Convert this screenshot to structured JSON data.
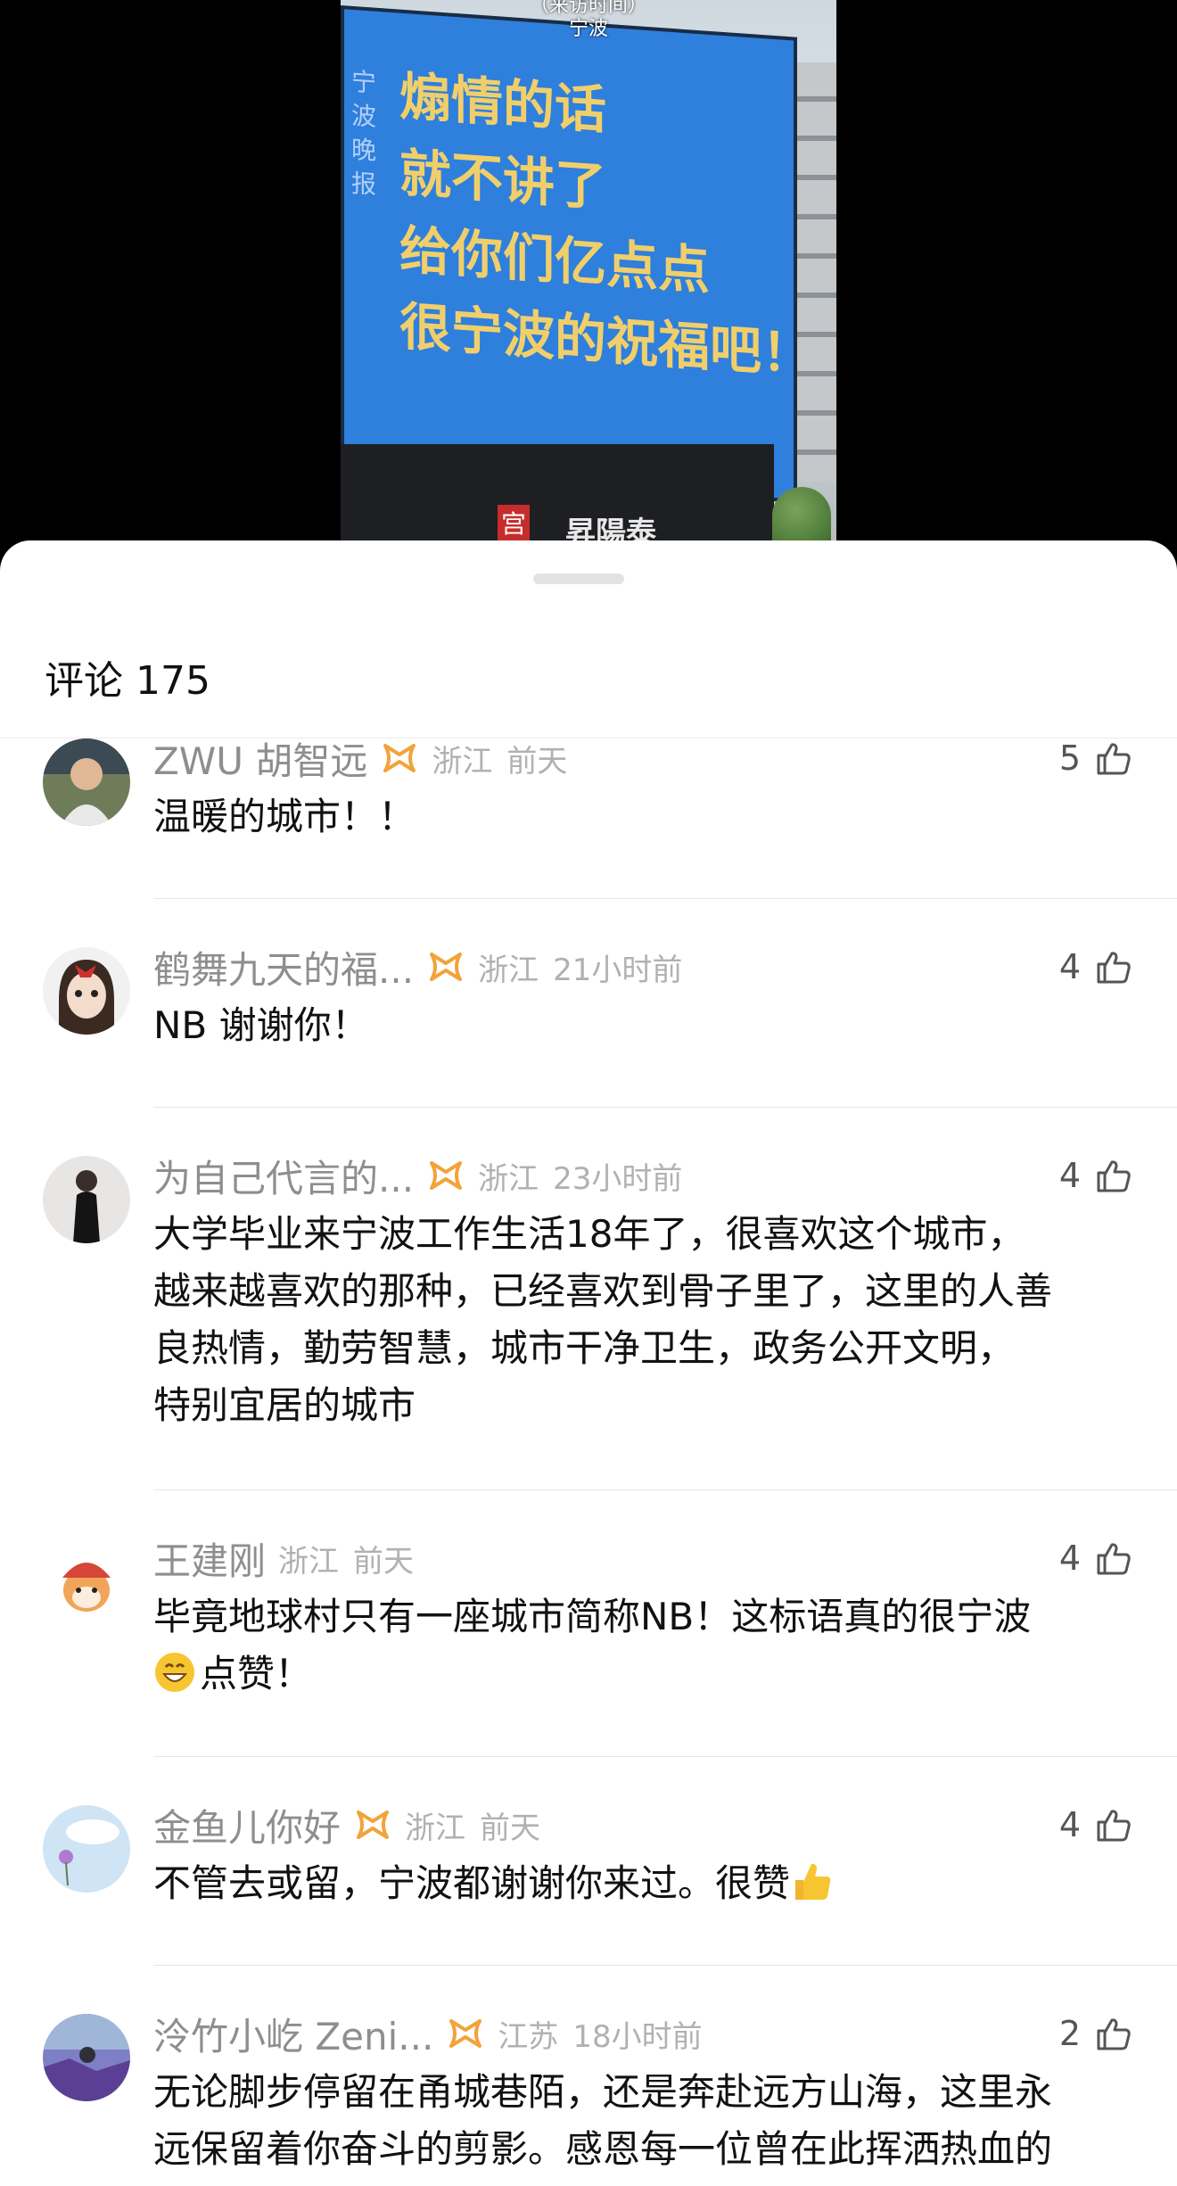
{
  "video": {
    "caption_top": "（来访时间）",
    "caption_city": "宁波",
    "screen_lines": [
      "煽情的话",
      "就不讲了",
      "给你们亿点点",
      "很宁波的祝福吧！"
    ],
    "screen_side_text": "宁波晚报",
    "brand_sign": "宫",
    "brand_name": "昇陽泰"
  },
  "sheet": {
    "title": "评论 175"
  },
  "comments": [
    {
      "username": "ZWU 胡智远",
      "vip": true,
      "location": "浙江",
      "time": "前天",
      "likes": "5",
      "text": [
        "温暖的城市！！"
      ]
    },
    {
      "username": "鹤舞九天的福...",
      "vip": true,
      "location": "浙江",
      "time": "21小时前",
      "likes": "4",
      "text": [
        "NB 谢谢你！"
      ]
    },
    {
      "username": "为自己代言的...",
      "vip": true,
      "location": "浙江",
      "time": "23小时前",
      "likes": "4",
      "text": [
        "大学毕业来宁波工作生活18年了，很喜欢这个城市，",
        "越来越喜欢的那种，已经喜欢到骨子里了，这里的人善",
        "良热情，勤劳智慧，城市干净卫生，政务公开文明，",
        "特别宜居的城市"
      ]
    },
    {
      "username": "王建刚",
      "vip": false,
      "location": "浙江",
      "time": "前天",
      "likes": "4",
      "text": [
        "毕竟地球村只有一座城市简称NB！这标语真的很宁波",
        "点赞！"
      ]
    },
    {
      "username": "金鱼儿你好",
      "vip": true,
      "location": "浙江",
      "time": "前天",
      "likes": "4",
      "text": [
        "不管去或留，宁波都谢谢你来过。很赞"
      ]
    },
    {
      "username": "泠竹小屹 Zeni...",
      "vip": true,
      "location": "江苏",
      "time": "18小时前",
      "likes": "2",
      "text": [
        "无论脚步停留在甬城巷陌，还是奔赴远方山海，这里永",
        "远保留着你奋斗的剪影。感恩每一位曾在此挥洒热血的"
      ]
    }
  ],
  "icons": {
    "like": "thumbs-up-icon",
    "vip": "vip-badge-icon",
    "emoji_grin": "grinning-emoji-icon",
    "emoji_thumb": "thumbs-up-emoji-icon"
  },
  "colors": {
    "screen_blue": "#2f7fdc",
    "screen_text": "#f0cf6b",
    "vip_orange": "#f2a33a"
  }
}
